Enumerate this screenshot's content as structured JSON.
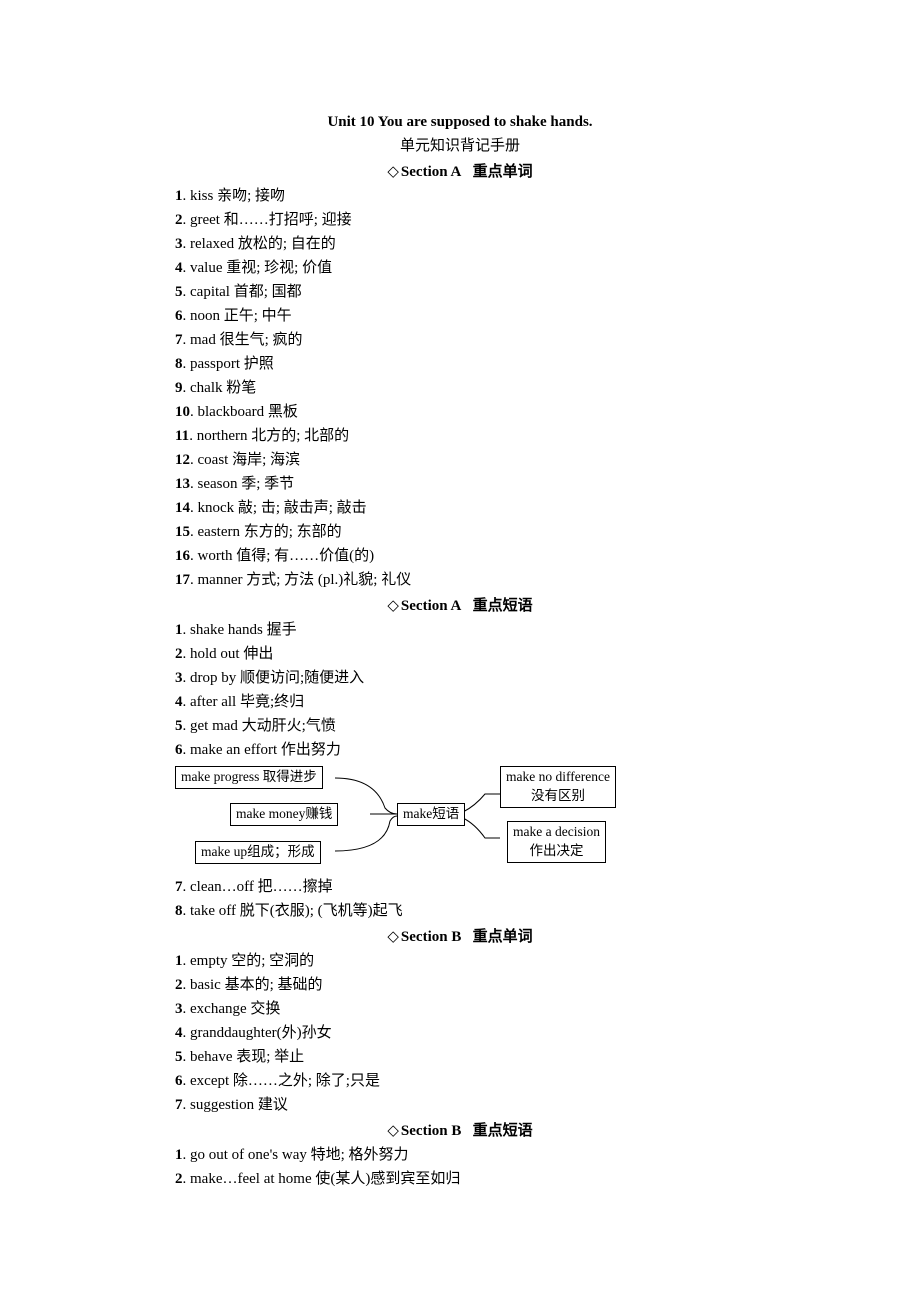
{
  "title": "Unit 10 You are supposed to shake hands.",
  "subtitle": "单元知识背记手册",
  "sections": [
    {
      "heading_prefix": "◇",
      "heading_main": "Section A",
      "heading_tail": "重点单词",
      "items": [
        {
          "n": "1",
          "text": ". kiss 亲吻;  接吻"
        },
        {
          "n": "2",
          "text": ". greet  和……打招呼;  迎接"
        },
        {
          "n": "3",
          "text": ". relaxed  放松的;  自在的"
        },
        {
          "n": "4",
          "text": ". value  重视;  珍视;  价值"
        },
        {
          "n": "5",
          "text": ". capital  首都;  国都"
        },
        {
          "n": "6",
          "text": ". noon  正午;  中午"
        },
        {
          "n": "7",
          "text": ". mad  很生气;  疯的"
        },
        {
          "n": "8",
          "text": ". passport  护照"
        },
        {
          "n": "9",
          "text": ". chalk  粉笔"
        },
        {
          "n": "10",
          "text": ". blackboard  黑板"
        },
        {
          "n": "11",
          "text": ". northern  北方的;  北部的"
        },
        {
          "n": "12",
          "text": ". coast  海岸;  海滨"
        },
        {
          "n": "13",
          "text": ". season  季;  季节"
        },
        {
          "n": "14",
          "text": ". knock 敲;  击;  敲击声;  敲击"
        },
        {
          "n": "15",
          "text": ". eastern  东方的;  东部的"
        },
        {
          "n": "16",
          "text": ". worth  值得;  有……价值(的)"
        },
        {
          "n": "17",
          "text": ". manner  方式;  方法  (pl.)礼貌;  礼仪"
        }
      ]
    },
    {
      "heading_prefix": "◇",
      "heading_main": "Section A",
      "heading_tail": "重点短语",
      "items": [
        {
          "n": "1",
          "text": ". shake hands  握手"
        },
        {
          "n": "2",
          "text": ". hold out  伸出"
        },
        {
          "n": "3",
          "text": ". drop by  顺便访问;随便进入"
        },
        {
          "n": "4",
          "text": ". after all  毕竟;终归"
        },
        {
          "n": "5",
          "text": ". get mad  大动肝火;气愤"
        },
        {
          "n": "6",
          "text": ". make an effort  作出努力"
        }
      ],
      "diagram": {
        "center": "make短语",
        "left_top": "make progress 取得进步",
        "left_mid": "make money赚钱",
        "left_bot": "make up组成；形成",
        "right_top_l1": "make no difference",
        "right_top_l2": "没有区别",
        "right_bot_l1": "make a decision",
        "right_bot_l2": "作出决定"
      },
      "items_after": [
        {
          "n": "7",
          "text": ". clean…off 把……擦掉"
        },
        {
          "n": "8",
          "text": ". take off 脱下(衣服);  (飞机等)起飞"
        }
      ]
    },
    {
      "heading_prefix": "◇",
      "heading_main": "Section B",
      "heading_tail": "重点单词",
      "items": [
        {
          "n": "1",
          "text": ". empty  空的;  空洞的"
        },
        {
          "n": "2",
          "text": ". basic  基本的;  基础的"
        },
        {
          "n": "3",
          "text": ". exchange  交换"
        },
        {
          "n": "4",
          "text": ". granddaughter(外)孙女"
        },
        {
          "n": "5",
          "text": ". behave  表现;  举止"
        },
        {
          "n": "6",
          "text": ". except  除……之外;  除了;只是"
        },
        {
          "n": "7",
          "text": ". suggestion  建议"
        }
      ]
    },
    {
      "heading_prefix": "◇",
      "heading_main": "Section B",
      "heading_tail": "重点短语",
      "items": [
        {
          "n": "1",
          "text": ". go out of one's way  特地;  格外努力"
        },
        {
          "n": "2",
          "text": ". make…feel at home  使(某人)感到宾至如归"
        }
      ]
    }
  ]
}
